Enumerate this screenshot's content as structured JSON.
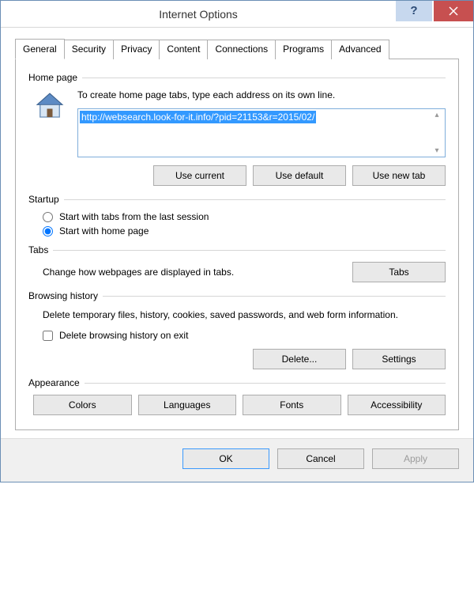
{
  "window": {
    "title": "Internet Options"
  },
  "tabs": [
    "General",
    "Security",
    "Privacy",
    "Content",
    "Connections",
    "Programs",
    "Advanced"
  ],
  "homepage": {
    "group": "Home page",
    "desc": "To create home page tabs, type each address on its own line.",
    "url": "http://websearch.look-for-it.info/?pid=21153&r=2015/02/",
    "use_current": "Use current",
    "use_default": "Use default",
    "use_new_tab": "Use new tab"
  },
  "startup": {
    "group": "Startup",
    "opt1": "Start with tabs from the last session",
    "opt2": "Start with home page"
  },
  "tabsSection": {
    "group": "Tabs",
    "desc": "Change how webpages are displayed in tabs.",
    "btn": "Tabs"
  },
  "history": {
    "group": "Browsing history",
    "desc": "Delete temporary files, history, cookies, saved passwords, and web form information.",
    "checkbox": "Delete browsing history on exit",
    "delete": "Delete...",
    "settings": "Settings"
  },
  "appearance": {
    "group": "Appearance",
    "colors": "Colors",
    "languages": "Languages",
    "fonts": "Fonts",
    "accessibility": "Accessibility"
  },
  "footer": {
    "ok": "OK",
    "cancel": "Cancel",
    "apply": "Apply"
  }
}
